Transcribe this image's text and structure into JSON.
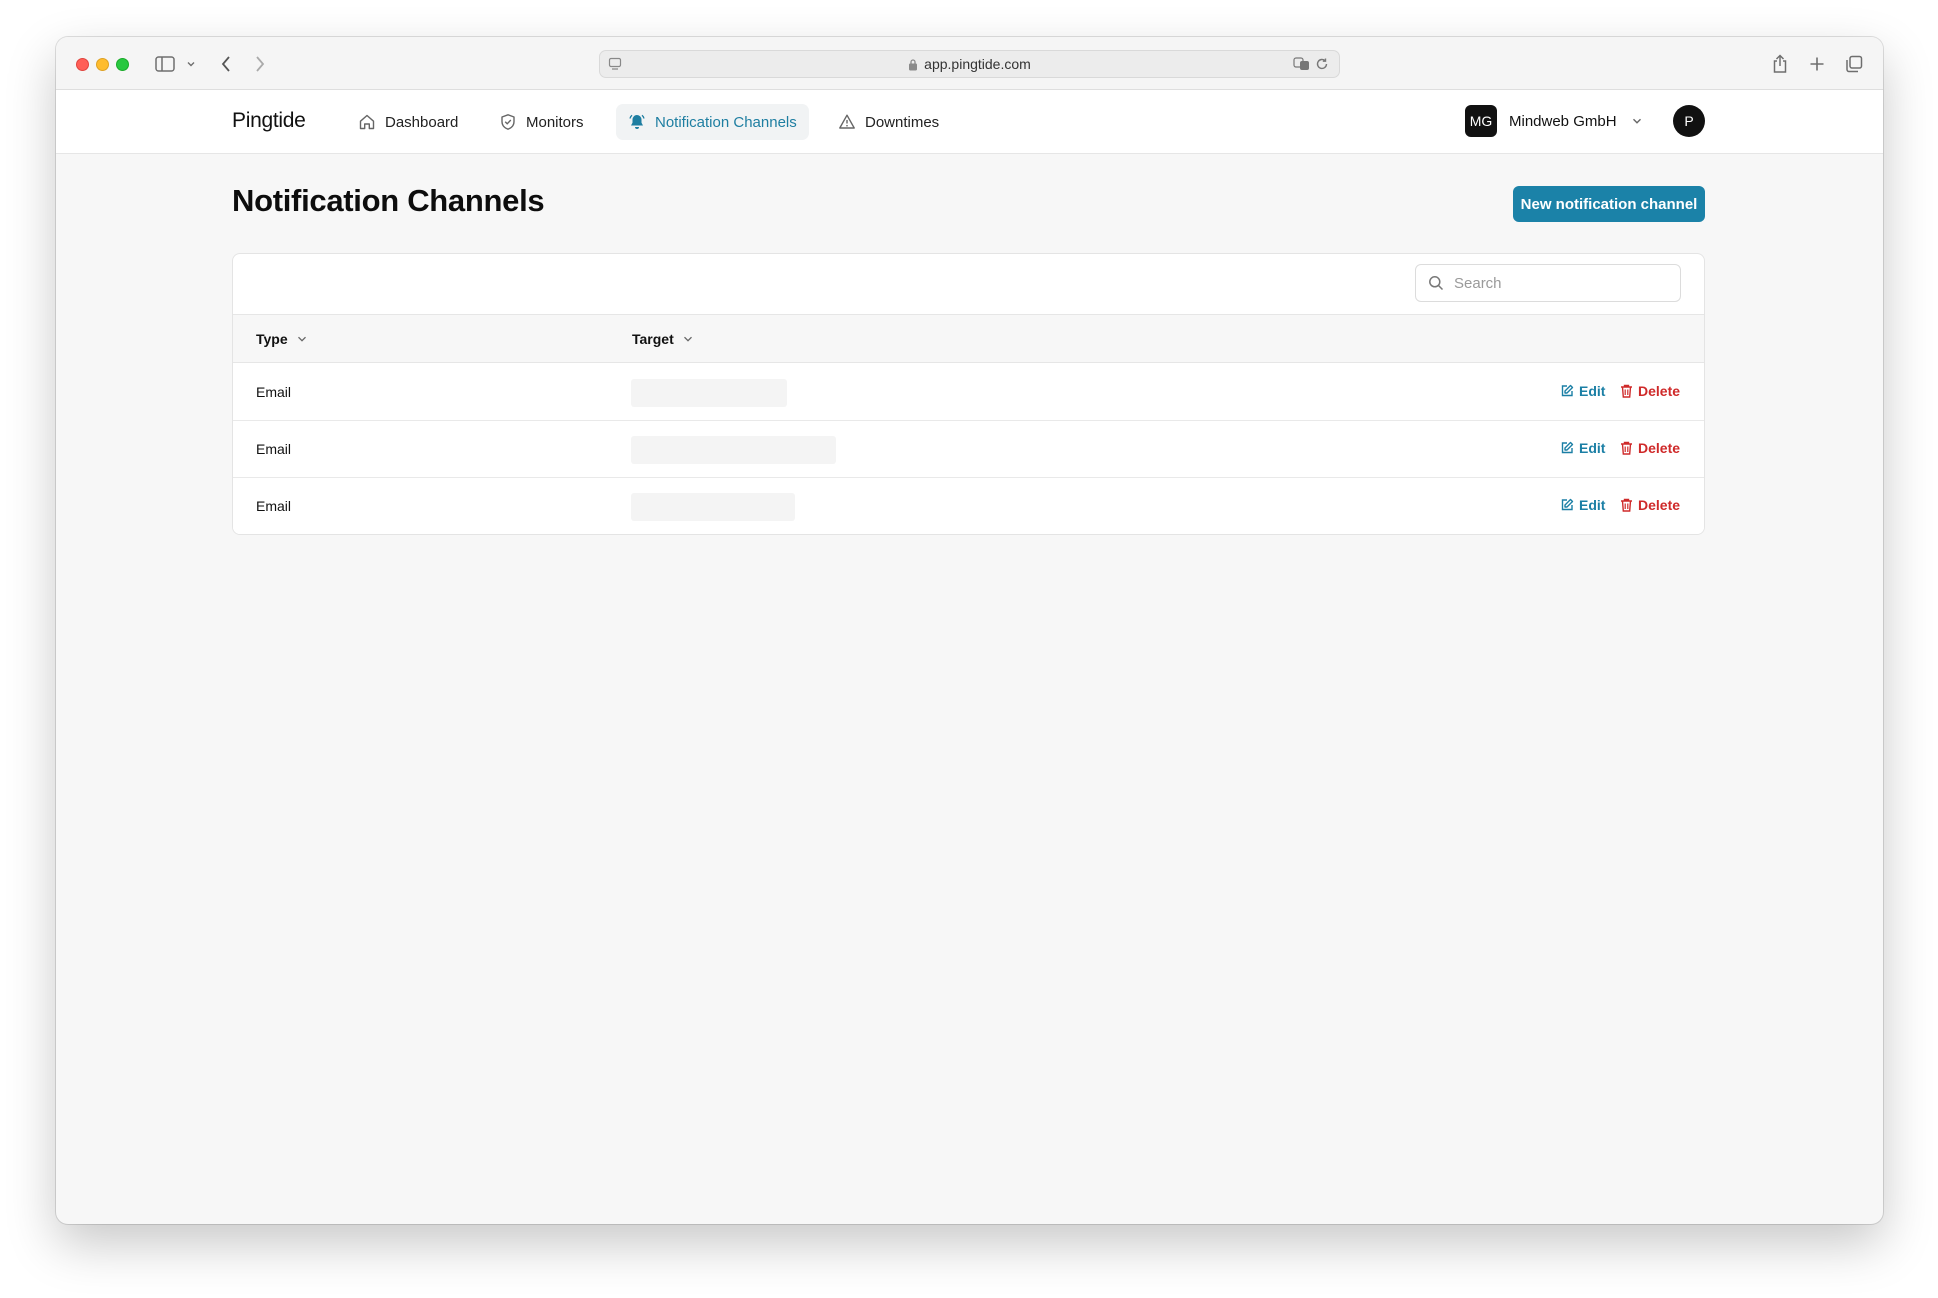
{
  "browser": {
    "url": "app.pingtide.com"
  },
  "app": {
    "logo": "Pingtide",
    "nav": [
      {
        "label": "Dashboard",
        "icon": "home-icon",
        "active": false
      },
      {
        "label": "Monitors",
        "icon": "shield-check-icon",
        "active": false
      },
      {
        "label": "Notification Channels",
        "icon": "bell-icon",
        "active": true
      },
      {
        "label": "Downtimes",
        "icon": "warning-triangle-icon",
        "active": false
      }
    ],
    "org": {
      "initials": "MG",
      "name": "Mindweb GmbH"
    },
    "user_initial": "P"
  },
  "page": {
    "title": "Notification Channels",
    "new_button": "New notification channel",
    "search_placeholder": "Search"
  },
  "table": {
    "columns": [
      "Type",
      "Target"
    ],
    "rows": [
      {
        "type": "Email",
        "target": ""
      },
      {
        "type": "Email",
        "target": ""
      },
      {
        "type": "Email",
        "target": ""
      }
    ],
    "edit_label": "Edit",
    "delete_label": "Delete"
  },
  "colors": {
    "accent": "#1b82a8",
    "danger": "#cf2a2a"
  }
}
